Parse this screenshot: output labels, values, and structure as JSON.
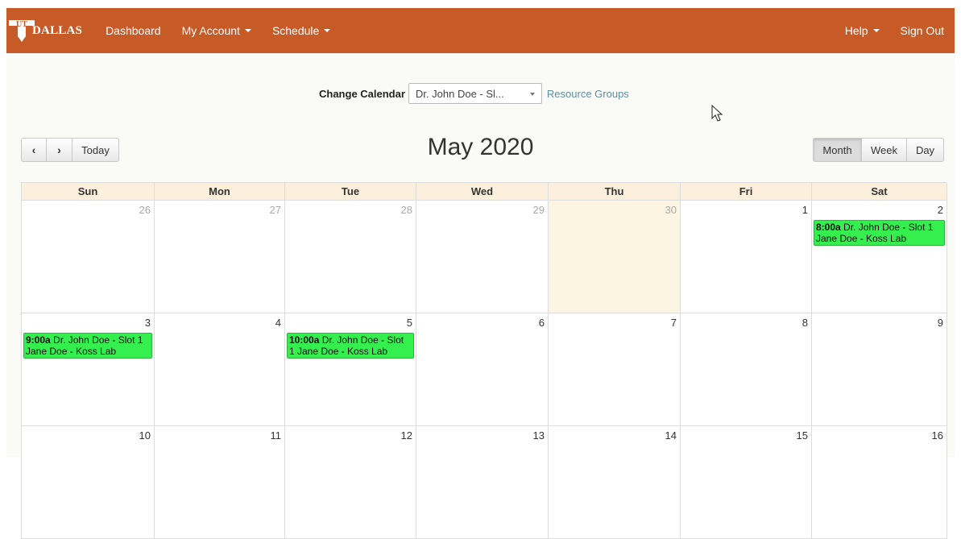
{
  "navbar": {
    "brand_text": "DALLAS",
    "brand_initials": "UT",
    "items": [
      {
        "label": "Dashboard",
        "dropdown": false
      },
      {
        "label": "My Account",
        "dropdown": true
      },
      {
        "label": "Schedule",
        "dropdown": true
      }
    ],
    "right_items": [
      {
        "label": "Help",
        "dropdown": true
      },
      {
        "label": "Sign Out",
        "dropdown": false
      }
    ],
    "color": "#c75b27"
  },
  "calendar_selector": {
    "label": "Change Calendar",
    "selected": "Dr. John Doe - Sl...",
    "link": "Resource Groups"
  },
  "toolbar": {
    "prev_icon": "chevron-left-icon",
    "next_icon": "chevron-right-icon",
    "today_label": "Today",
    "title": "May 2020",
    "views": [
      {
        "label": "Month",
        "active": true
      },
      {
        "label": "Week",
        "active": false
      },
      {
        "label": "Day",
        "active": false
      }
    ]
  },
  "calendar": {
    "weekdays": [
      "Sun",
      "Mon",
      "Tue",
      "Wed",
      "Thu",
      "Fri",
      "Sat"
    ],
    "weeks": [
      [
        {
          "day": "26",
          "other": true
        },
        {
          "day": "27",
          "other": true
        },
        {
          "day": "28",
          "other": true
        },
        {
          "day": "29",
          "other": true
        },
        {
          "day": "30",
          "other": true,
          "today": true
        },
        {
          "day": "1"
        },
        {
          "day": "2",
          "event": {
            "time": "8:00a",
            "title": "Dr. John Doe - Slot 1 Jane Doe - Koss Lab"
          }
        }
      ],
      [
        {
          "day": "3",
          "event": {
            "time": "9:00a",
            "title": "Dr. John Doe - Slot 1 Jane Doe - Koss Lab"
          }
        },
        {
          "day": "4"
        },
        {
          "day": "5",
          "event": {
            "time": "10:00a",
            "title": "Dr. John Doe - Slot 1 Jane Doe - Koss Lab"
          }
        },
        {
          "day": "6"
        },
        {
          "day": "7"
        },
        {
          "day": "8"
        },
        {
          "day": "9"
        }
      ],
      [
        {
          "day": "10"
        },
        {
          "day": "11"
        },
        {
          "day": "12"
        },
        {
          "day": "13"
        },
        {
          "day": "14"
        },
        {
          "day": "15"
        },
        {
          "day": "16"
        }
      ]
    ],
    "event_color": "#35ef4f",
    "today_color": "#fcf5e1",
    "header_color": "#fcf0dc"
  }
}
